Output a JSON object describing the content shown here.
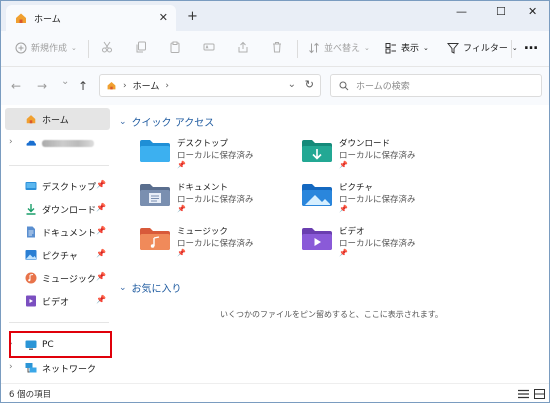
{
  "tab": {
    "label": "ホーム",
    "close": "✕"
  },
  "newtab": "+",
  "window": {
    "minimize": "—",
    "maximize": "☐",
    "close": "✕"
  },
  "toolbar": {
    "new_label": "新規作成",
    "sort_label": "並べ替え",
    "view_label": "表示",
    "filter_label": "フィルター",
    "more": "…"
  },
  "nav": {
    "back": "←",
    "forward": "→",
    "recent": "⌄",
    "up": "↑"
  },
  "address": {
    "crumb": "ホーム",
    "sep": "›",
    "dropdown": "⌄",
    "refresh": "↻"
  },
  "search": {
    "placeholder": "ホームの検索"
  },
  "sidebar": {
    "home": "ホーム",
    "items": [
      {
        "label": "デスクトップ",
        "icon": "desktop-icon"
      },
      {
        "label": "ダウンロード",
        "icon": "download-icon"
      },
      {
        "label": "ドキュメント",
        "icon": "document-icon"
      },
      {
        "label": "ピクチャ",
        "icon": "pictures-icon"
      },
      {
        "label": "ミュージック",
        "icon": "music-icon"
      },
      {
        "label": "ビデオ",
        "icon": "video-icon"
      }
    ],
    "pc": "PC",
    "network": "ネットワーク"
  },
  "main": {
    "quick_access": "クイック アクセス",
    "folders": [
      {
        "name": "デスクトップ",
        "sub": "ローカルに保存済み",
        "color": "#1f8fd6"
      },
      {
        "name": "ダウンロード",
        "sub": "ローカルに保存済み",
        "color": "#1a9e8e"
      },
      {
        "name": "ドキュメント",
        "sub": "ローカルに保存済み",
        "color": "#6a7fa0"
      },
      {
        "name": "ピクチャ",
        "sub": "ローカルに保存済み",
        "color": "#1a7fd0"
      },
      {
        "name": "ミュージック",
        "sub": "ローカルに保存済み",
        "color": "#e8734a"
      },
      {
        "name": "ビデオ",
        "sub": "ローカルに保存済み",
        "color": "#7b4fc0"
      }
    ],
    "favorites": "お気に入り",
    "empty_msg": "いくつかのファイルをピン留めすると、ここに表示されます。"
  },
  "status": {
    "count": "6 個の項目"
  },
  "colors": {
    "accent": "#1f5ba0",
    "highlight_box": "#e0000a",
    "titlebar": "#e9eef6"
  }
}
